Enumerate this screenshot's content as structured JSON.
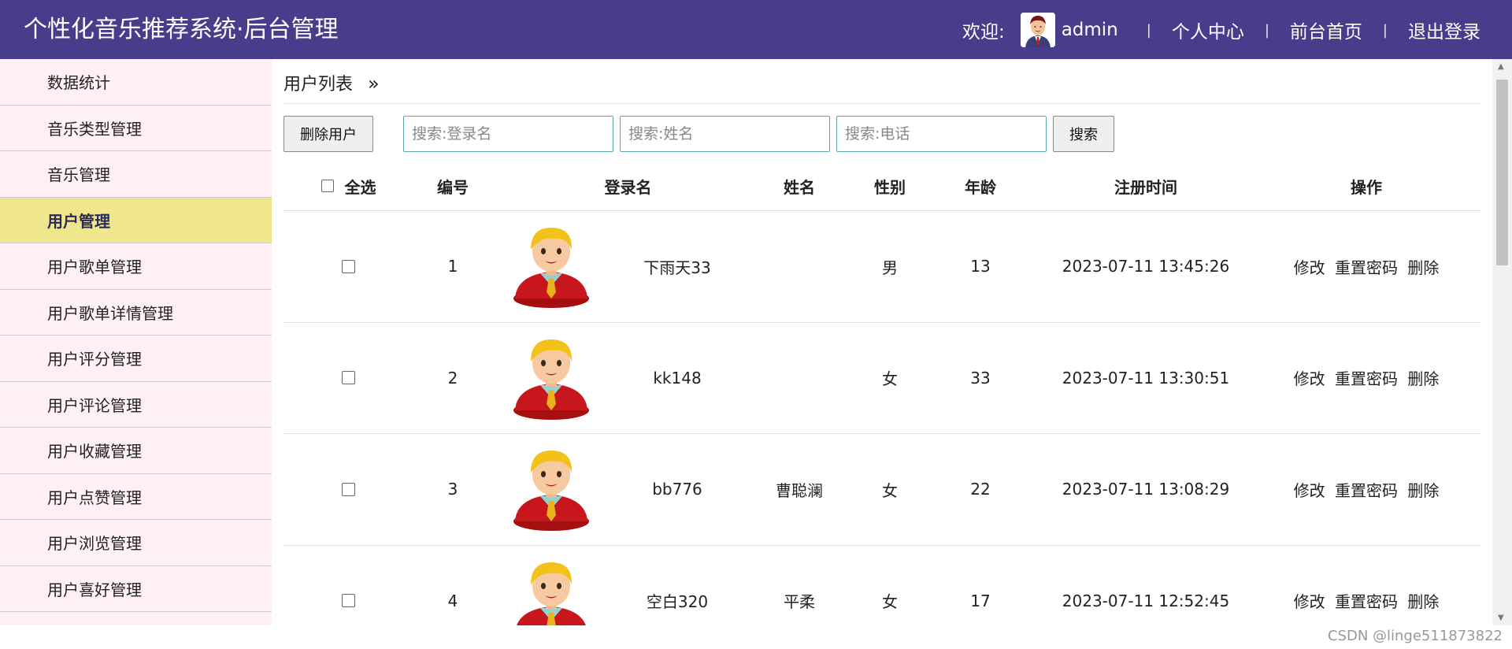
{
  "header": {
    "title": "个性化音乐推荐系统·后台管理",
    "welcome": "欢迎:",
    "username": "admin",
    "nav": [
      "个人中心",
      "前台首页",
      "退出登录"
    ],
    "separator": "|"
  },
  "sidebar": {
    "items": [
      {
        "label": "数据统计"
      },
      {
        "label": "音乐类型管理"
      },
      {
        "label": "音乐管理"
      },
      {
        "label": "用户管理"
      },
      {
        "label": "用户歌单管理"
      },
      {
        "label": "用户歌单详情管理"
      },
      {
        "label": "用户评分管理"
      },
      {
        "label": "用户评论管理"
      },
      {
        "label": "用户收藏管理"
      },
      {
        "label": "用户点赞管理"
      },
      {
        "label": "用户浏览管理"
      },
      {
        "label": "用户喜好管理"
      }
    ],
    "active_index": 3
  },
  "main": {
    "breadcrumb": "用户列表",
    "breadcrumb_arrow": "»",
    "toolbar": {
      "delete_label": "删除用户",
      "search_login_placeholder": "搜索:登录名",
      "search_name_placeholder": "搜索:姓名",
      "search_phone_placeholder": "搜索:电话",
      "search_label": "搜索"
    },
    "table": {
      "headers": {
        "select_all": "全选",
        "id": "编号",
        "login": "登录名",
        "name": "姓名",
        "gender": "性别",
        "age": "年龄",
        "time": "注册时间",
        "ops": "操作"
      },
      "rows": [
        {
          "id": "1",
          "login": "下雨天33",
          "name": "",
          "gender": "男",
          "age": "13",
          "time": "2023-07-11 13:45:26"
        },
        {
          "id": "2",
          "login": "kk148",
          "name": "",
          "gender": "女",
          "age": "33",
          "time": "2023-07-11 13:30:51"
        },
        {
          "id": "3",
          "login": "bb776",
          "name": "曹聪澜",
          "gender": "女",
          "age": "22",
          "time": "2023-07-11 13:08:29"
        },
        {
          "id": "4",
          "login": "空白320",
          "name": "平柔",
          "gender": "女",
          "age": "17",
          "time": "2023-07-11 12:52:45"
        }
      ],
      "ops": {
        "edit": "修改",
        "reset": "重置密码",
        "delete": "删除"
      }
    }
  },
  "watermark": "CSDN @linge511873822",
  "colors": {
    "header_bg": "#483d8b",
    "sidebar_bg": "#fff0f5",
    "sidebar_active": "#f0e68c"
  }
}
